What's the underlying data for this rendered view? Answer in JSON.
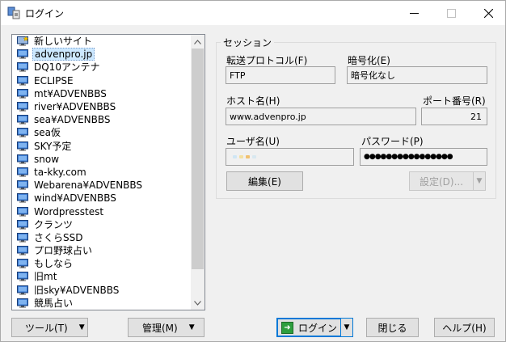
{
  "window": {
    "title": "ログイン"
  },
  "sites": [
    {
      "label": "新しいサイト",
      "icon": "new-site-icon",
      "selected": false
    },
    {
      "label": "advenpro.jp",
      "icon": "monitor-icon",
      "selected": true
    },
    {
      "label": "DQ10アンテナ",
      "icon": "monitor-icon",
      "selected": false
    },
    {
      "label": "ECLIPSE",
      "icon": "monitor-icon",
      "selected": false
    },
    {
      "label": "mt¥ADVENBBS",
      "icon": "monitor-icon",
      "selected": false
    },
    {
      "label": "river¥ADVENBBS",
      "icon": "monitor-icon",
      "selected": false
    },
    {
      "label": "sea¥ADVENBBS",
      "icon": "monitor-icon",
      "selected": false
    },
    {
      "label": "sea仮",
      "icon": "monitor-icon",
      "selected": false
    },
    {
      "label": "SKY予定",
      "icon": "monitor-icon",
      "selected": false
    },
    {
      "label": "snow",
      "icon": "monitor-icon",
      "selected": false
    },
    {
      "label": "ta-kky.com",
      "icon": "monitor-icon",
      "selected": false
    },
    {
      "label": "Webarena¥ADVENBBS",
      "icon": "monitor-icon",
      "selected": false
    },
    {
      "label": "wind¥ADVENBBS",
      "icon": "monitor-icon",
      "selected": false
    },
    {
      "label": "Wordpresstest",
      "icon": "monitor-icon",
      "selected": false
    },
    {
      "label": "クランツ",
      "icon": "monitor-icon",
      "selected": false
    },
    {
      "label": "さくらSSD",
      "icon": "monitor-icon",
      "selected": false
    },
    {
      "label": "プロ野球占い",
      "icon": "monitor-icon",
      "selected": false
    },
    {
      "label": "もしなら",
      "icon": "monitor-icon",
      "selected": false
    },
    {
      "label": "旧mt",
      "icon": "monitor-icon",
      "selected": false
    },
    {
      "label": "旧sky¥ADVENBBS",
      "icon": "monitor-icon",
      "selected": false
    },
    {
      "label": "競馬占い",
      "icon": "monitor-icon",
      "selected": false
    }
  ],
  "session": {
    "group_title": "セッション",
    "protocol_label": "転送プロトコル(F)",
    "protocol_value": "FTP",
    "encryption_label": "暗号化(E)",
    "encryption_value": "暗号化なし",
    "host_label": "ホスト名(H)",
    "host_value": "www.advenpro.jp",
    "port_label": "ポート番号(R)",
    "port_value": "21",
    "user_label": "ユーザ名(U)",
    "password_label": "パスワード(P)",
    "password_value": "●●●●●●●●●●●●●●●●",
    "edit_label": "編集(E)",
    "settings_label": "設定(D)..."
  },
  "buttons": {
    "tools": "ツール(T)",
    "manage": "管理(M)",
    "login": "ログイン",
    "close": "閉じる",
    "help": "ヘルプ(H)"
  },
  "colors": {
    "selection": "#cce8ff",
    "accent": "#0078d7",
    "login_icon": "#2e9e3e"
  }
}
